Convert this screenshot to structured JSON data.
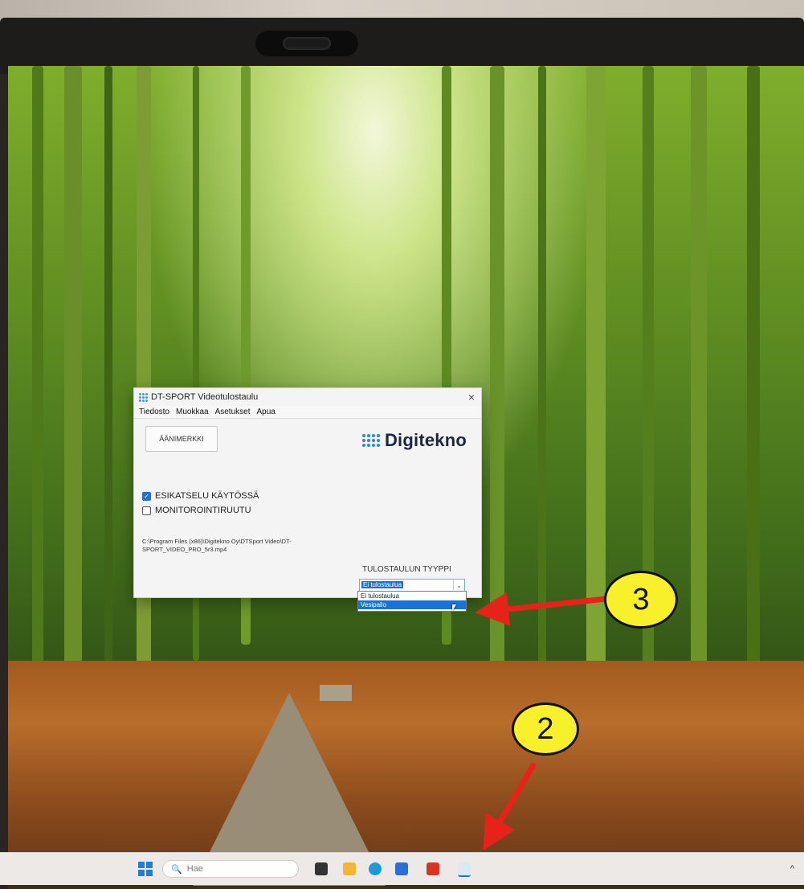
{
  "window": {
    "title": "DT-SPORT Videotulostaulu",
    "close_glyph": "×",
    "menu": [
      "Tiedosto",
      "Muokkaa",
      "Asetukset",
      "Apua"
    ],
    "sound_button": "ÄÄNIMERKKI",
    "logo_text": "Digitekno",
    "checkboxes": [
      {
        "label": "ESIKATSELU KÄYTÖSSÄ",
        "checked": true
      },
      {
        "label": "MONITOROINTIRUUTU",
        "checked": false
      }
    ],
    "file_path": "C:\\Program Files (x86)\\Digitekno Oy\\DTSport Video\\DT-SPORT_VIDEO_PRO_5r3.mp4",
    "type_label": "TULOSTAULUN TYYPPI",
    "type_select": {
      "selected": "Ei tulostaulua",
      "options": [
        "Ei tulostaulua",
        "Vesipallo"
      ],
      "highlighted": "Vesipallo"
    }
  },
  "taskbar": {
    "search_placeholder": "Hae",
    "tray_caret": "^"
  },
  "annotations": {
    "badge_3": "3",
    "badge_2": "2"
  },
  "colors": {
    "accent": "#1a73d8",
    "logo_dots": "#1f8fd6",
    "badge_fill": "#f7f02a",
    "arrow": "#e8221b"
  }
}
